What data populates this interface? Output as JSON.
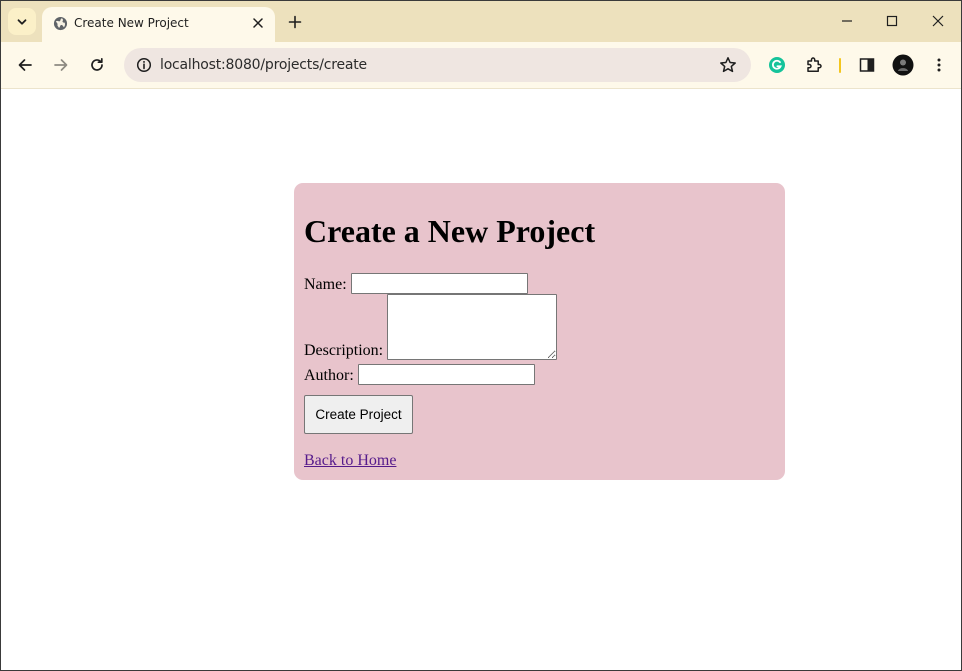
{
  "browser": {
    "tab": {
      "title": "Create New Project",
      "favicon": "globe-icon"
    },
    "address_bar": {
      "url": "localhost:8080/projects/create"
    },
    "colors": {
      "tabstrip": "#ede1bd",
      "toolbar": "#fef9ea",
      "omnibox": "#efe6e1"
    }
  },
  "page": {
    "heading": "Create a New Project",
    "form": {
      "name_label": "Name:",
      "name_value": "",
      "description_label": "Description:",
      "description_value": "",
      "author_label": "Author:",
      "author_value": "",
      "submit_label": "Create Project"
    },
    "back_link": "Back to Home",
    "colors": {
      "card_background": "#e8c4cc",
      "link": "#551a8b"
    }
  }
}
